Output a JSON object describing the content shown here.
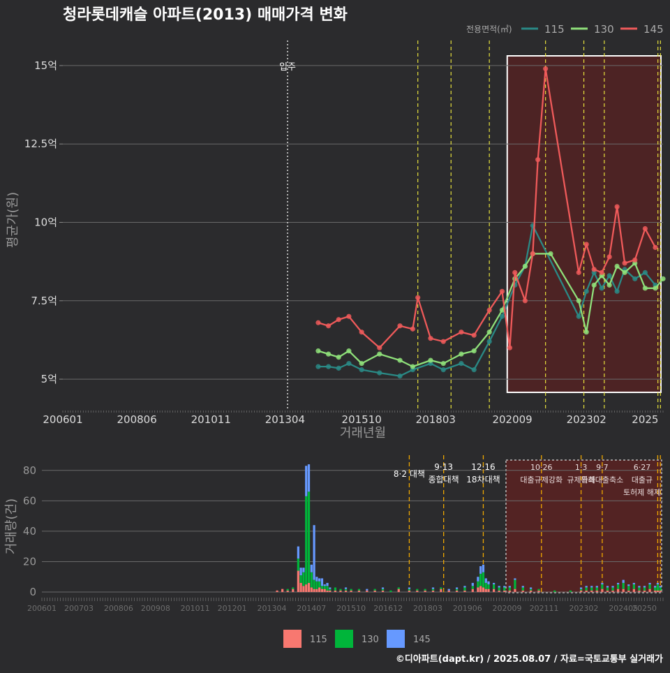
{
  "title": "청라롯데캐슬 아파트(2013) 매매가격 변화",
  "legend_title": "전용면적(㎡)",
  "credit": "©디아파트(dapt.kr) / 2025.08.07 / 자료=국토교통부 실거래가",
  "colors": {
    "line115": "#2a8a86",
    "line130": "#8fe07a",
    "line145": "#ef5a5a",
    "bar115": "#f87870",
    "bar130": "#00b53a",
    "bar145": "#6699ff",
    "regulation": "#e8e23c",
    "highlight": "#5a2222"
  },
  "chart_data": [
    {
      "type": "line",
      "title": "청라롯데캐슬 아파트(2013) 매매가격 변화",
      "xlabel": "거래년월",
      "ylabel": "평균가(원)",
      "x_ticks": [
        "200601",
        "200806",
        "201011",
        "201304",
        "201510",
        "201803",
        "202009",
        "202302",
        "2025"
      ],
      "y_ticks": [
        "5억",
        "7.5억",
        "10억",
        "12.5억",
        "15억"
      ],
      "y_tick_values": [
        5,
        7.5,
        10,
        12.5,
        15
      ],
      "ylim": [
        4,
        15.8
      ],
      "xlim": [
        "2006-01",
        "2025-08"
      ],
      "move_in_label": "입주",
      "move_in_date": "2013-05",
      "regulation_dates": [
        "2017-08",
        "2018-09",
        "2019-12",
        "2021-10",
        "2023-01",
        "2023-09",
        "2025-06",
        "2025-07"
      ],
      "highlight_range": [
        "2020-07",
        "2025-08"
      ],
      "series": [
        {
          "name": "115",
          "points": [
            [
              "2014-05",
              5.4
            ],
            [
              "2014-09",
              5.4
            ],
            [
              "2015-01",
              5.35
            ],
            [
              "2015-05",
              5.5
            ],
            [
              "2015-10",
              5.3
            ],
            [
              "2016-05",
              5.2
            ],
            [
              "2017-01",
              5.1
            ],
            [
              "2017-06",
              5.3
            ],
            [
              "2018-01",
              5.5
            ],
            [
              "2018-06",
              5.3
            ],
            [
              "2019-01",
              5.5
            ],
            [
              "2019-06",
              5.3
            ],
            [
              "2019-12",
              6.2
            ],
            [
              "2020-05",
              7.0
            ],
            [
              "2020-10",
              8.0
            ],
            [
              "2021-02",
              8.6
            ],
            [
              "2021-05",
              9.9
            ],
            [
              "2022-11",
              7.0
            ],
            [
              "2023-02",
              7.8
            ],
            [
              "2023-05",
              8.4
            ],
            [
              "2023-08",
              7.9
            ],
            [
              "2023-11",
              8.3
            ],
            [
              "2024-02",
              7.8
            ],
            [
              "2024-05",
              8.5
            ],
            [
              "2024-09",
              8.2
            ],
            [
              "2025-01",
              8.4
            ],
            [
              "2025-05",
              8.0
            ]
          ]
        },
        {
          "name": "130",
          "points": [
            [
              "2014-05",
              5.9
            ],
            [
              "2014-09",
              5.8
            ],
            [
              "2015-01",
              5.7
            ],
            [
              "2015-05",
              5.9
            ],
            [
              "2015-10",
              5.5
            ],
            [
              "2016-05",
              5.8
            ],
            [
              "2017-01",
              5.6
            ],
            [
              "2017-06",
              5.4
            ],
            [
              "2018-01",
              5.6
            ],
            [
              "2018-06",
              5.5
            ],
            [
              "2019-01",
              5.8
            ],
            [
              "2019-06",
              5.9
            ],
            [
              "2019-12",
              6.5
            ],
            [
              "2020-05",
              7.2
            ],
            [
              "2020-10",
              8.2
            ],
            [
              "2021-02",
              8.6
            ],
            [
              "2021-05",
              9.0
            ],
            [
              "2021-12",
              9.0
            ],
            [
              "2022-11",
              7.5
            ],
            [
              "2023-02",
              6.5
            ],
            [
              "2023-05",
              8.0
            ],
            [
              "2023-08",
              8.3
            ],
            [
              "2023-11",
              8.0
            ],
            [
              "2024-02",
              8.6
            ],
            [
              "2024-05",
              8.4
            ],
            [
              "2024-09",
              8.7
            ],
            [
              "2025-01",
              7.9
            ],
            [
              "2025-05",
              7.9
            ],
            [
              "2025-08",
              8.2
            ]
          ]
        },
        {
          "name": "145",
          "points": [
            [
              "2014-05",
              6.8
            ],
            [
              "2014-09",
              6.7
            ],
            [
              "2015-01",
              6.9
            ],
            [
              "2015-05",
              7.0
            ],
            [
              "2015-10",
              6.5
            ],
            [
              "2016-05",
              6.0
            ],
            [
              "2017-01",
              6.7
            ],
            [
              "2017-06",
              6.6
            ],
            [
              "2017-08",
              7.6
            ],
            [
              "2018-01",
              6.3
            ],
            [
              "2018-06",
              6.2
            ],
            [
              "2019-01",
              6.5
            ],
            [
              "2019-06",
              6.4
            ],
            [
              "2019-12",
              7.2
            ],
            [
              "2020-05",
              7.8
            ],
            [
              "2020-08",
              6.0
            ],
            [
              "2020-10",
              8.4
            ],
            [
              "2021-02",
              7.5
            ],
            [
              "2021-05",
              9.0
            ],
            [
              "2021-07",
              12.0
            ],
            [
              "2021-10",
              14.9
            ],
            [
              "2022-11",
              8.4
            ],
            [
              "2023-02",
              9.3
            ],
            [
              "2023-05",
              8.5
            ],
            [
              "2023-08",
              8.4
            ],
            [
              "2023-11",
              8.9
            ],
            [
              "2024-02",
              10.5
            ],
            [
              "2024-05",
              8.7
            ],
            [
              "2024-09",
              8.8
            ],
            [
              "2025-01",
              9.8
            ],
            [
              "2025-05",
              9.2
            ]
          ]
        }
      ]
    },
    {
      "type": "bar",
      "stacked": true,
      "ylabel": "거래량(건)",
      "y_ticks": [
        "0",
        "20",
        "40",
        "60",
        "80"
      ],
      "y_tick_values": [
        0,
        20,
        40,
        60,
        80
      ],
      "ylim": [
        0,
        90
      ],
      "x_ticks": [
        "200601",
        "200703",
        "200806",
        "200908",
        "201011",
        "201201",
        "201304",
        "201407",
        "201510",
        "201612",
        "201803",
        "201906",
        "202009",
        "202111",
        "202302",
        "202405",
        "20250"
      ],
      "legend": [
        "115",
        "130",
        "145"
      ],
      "annotations": [
        {
          "date": "2017-08",
          "lines": [
            "8·2 대책"
          ]
        },
        {
          "date": "2018-09",
          "lines": [
            "9·13",
            "종합대책"
          ]
        },
        {
          "date": "2019-12",
          "lines": [
            "12·16",
            "18차대책"
          ]
        },
        {
          "date": "2021-10",
          "lines": [
            "10·26",
            "대출규제강화"
          ]
        },
        {
          "date": "2023-01",
          "lines": [
            "1·3",
            "규제완화"
          ]
        },
        {
          "date": "2023-09",
          "lines": [
            "9·7",
            "특례대출축소"
          ]
        },
        {
          "date": "2025-06",
          "lines": [
            "6·27",
            "대출규",
            "토허제 해제"
          ]
        }
      ],
      "months": [
        {
          "date": "2013-06",
          "v": [
            1,
            0,
            0
          ]
        },
        {
          "date": "2013-08",
          "v": [
            2,
            0,
            0
          ]
        },
        {
          "date": "2013-10",
          "v": [
            1,
            1,
            0
          ]
        },
        {
          "date": "2013-12",
          "v": [
            2,
            1,
            0
          ]
        },
        {
          "date": "2014-02",
          "v": [
            14,
            8,
            8
          ]
        },
        {
          "date": "2014-03",
          "v": [
            6,
            5,
            5
          ]
        },
        {
          "date": "2014-04",
          "v": [
            4,
            9,
            3
          ]
        },
        {
          "date": "2014-05",
          "v": [
            5,
            58,
            20
          ]
        },
        {
          "date": "2014-06",
          "v": [
            6,
            60,
            18
          ]
        },
        {
          "date": "2014-07",
          "v": [
            3,
            10,
            5
          ]
        },
        {
          "date": "2014-08",
          "v": [
            2,
            6,
            36
          ]
        },
        {
          "date": "2014-09",
          "v": [
            2,
            5,
            3
          ]
        },
        {
          "date": "2014-10",
          "v": [
            3,
            4,
            2
          ]
        },
        {
          "date": "2014-11",
          "v": [
            2,
            2,
            5
          ]
        },
        {
          "date": "2014-12",
          "v": [
            2,
            2,
            1
          ]
        },
        {
          "date": "2015-01",
          "v": [
            1,
            3,
            2
          ]
        },
        {
          "date": "2015-02",
          "v": [
            1,
            1,
            1
          ]
        },
        {
          "date": "2015-04",
          "v": [
            1,
            2,
            0
          ]
        },
        {
          "date": "2015-06",
          "v": [
            1,
            1,
            0
          ]
        },
        {
          "date": "2015-08",
          "v": [
            1,
            1,
            1
          ]
        },
        {
          "date": "2015-10",
          "v": [
            1,
            1,
            0
          ]
        },
        {
          "date": "2016-01",
          "v": [
            1,
            1,
            0
          ]
        },
        {
          "date": "2016-04",
          "v": [
            1,
            0,
            1
          ]
        },
        {
          "date": "2016-07",
          "v": [
            1,
            1,
            0
          ]
        },
        {
          "date": "2016-10",
          "v": [
            1,
            1,
            1
          ]
        },
        {
          "date": "2017-01",
          "v": [
            0,
            1,
            0
          ]
        },
        {
          "date": "2017-04",
          "v": [
            2,
            1,
            0
          ]
        },
        {
          "date": "2017-08",
          "v": [
            1,
            1,
            1
          ]
        },
        {
          "date": "2017-11",
          "v": [
            1,
            1,
            0
          ]
        },
        {
          "date": "2018-02",
          "v": [
            1,
            1,
            0
          ]
        },
        {
          "date": "2018-05",
          "v": [
            1,
            1,
            1
          ]
        },
        {
          "date": "2018-08",
          "v": [
            2,
            1,
            0
          ]
        },
        {
          "date": "2018-11",
          "v": [
            1,
            0,
            1
          ]
        },
        {
          "date": "2019-02",
          "v": [
            1,
            1,
            1
          ]
        },
        {
          "date": "2019-05",
          "v": [
            1,
            2,
            1
          ]
        },
        {
          "date": "2019-08",
          "v": [
            2,
            2,
            2
          ]
        },
        {
          "date": "2019-10",
          "v": [
            3,
            4,
            3
          ]
        },
        {
          "date": "2019-11",
          "v": [
            4,
            8,
            5
          ]
        },
        {
          "date": "2019-12",
          "v": [
            3,
            10,
            5
          ]
        },
        {
          "date": "2020-01",
          "v": [
            2,
            4,
            3
          ]
        },
        {
          "date": "2020-02",
          "v": [
            2,
            3,
            2
          ]
        },
        {
          "date": "2020-04",
          "v": [
            2,
            3,
            1
          ]
        },
        {
          "date": "2020-06",
          "v": [
            1,
            2,
            1
          ]
        },
        {
          "date": "2020-08",
          "v": [
            1,
            2,
            1
          ]
        },
        {
          "date": "2020-10",
          "v": [
            1,
            2,
            1
          ]
        },
        {
          "date": "2020-12",
          "v": [
            2,
            6,
            1
          ]
        },
        {
          "date": "2021-03",
          "v": [
            1,
            2,
            1
          ]
        },
        {
          "date": "2021-06",
          "v": [
            1,
            1,
            1
          ]
        },
        {
          "date": "2021-09",
          "v": [
            1,
            1,
            0
          ]
        },
        {
          "date": "2022-03",
          "v": [
            0,
            1,
            0
          ]
        },
        {
          "date": "2022-09",
          "v": [
            0,
            1,
            0
          ]
        },
        {
          "date": "2023-01",
          "v": [
            1,
            1,
            1
          ]
        },
        {
          "date": "2023-03",
          "v": [
            1,
            2,
            1
          ]
        },
        {
          "date": "2023-05",
          "v": [
            1,
            2,
            1
          ]
        },
        {
          "date": "2023-07",
          "v": [
            1,
            2,
            1
          ]
        },
        {
          "date": "2023-09",
          "v": [
            2,
            3,
            1
          ]
        },
        {
          "date": "2023-11",
          "v": [
            1,
            2,
            1
          ]
        },
        {
          "date": "2024-01",
          "v": [
            1,
            2,
            1
          ]
        },
        {
          "date": "2024-03",
          "v": [
            2,
            3,
            1
          ]
        },
        {
          "date": "2024-05",
          "v": [
            2,
            4,
            2
          ]
        },
        {
          "date": "2024-07",
          "v": [
            1,
            3,
            1
          ]
        },
        {
          "date": "2024-09",
          "v": [
            2,
            3,
            1
          ]
        },
        {
          "date": "2024-11",
          "v": [
            1,
            2,
            1
          ]
        },
        {
          "date": "2025-01",
          "v": [
            1,
            2,
            1
          ]
        },
        {
          "date": "2025-03",
          "v": [
            2,
            3,
            1
          ]
        },
        {
          "date": "2025-05",
          "v": [
            1,
            2,
            1
          ]
        },
        {
          "date": "2025-06",
          "v": [
            1,
            4,
            1
          ]
        },
        {
          "date": "2025-07",
          "v": [
            1,
            2,
            1
          ]
        }
      ]
    }
  ]
}
